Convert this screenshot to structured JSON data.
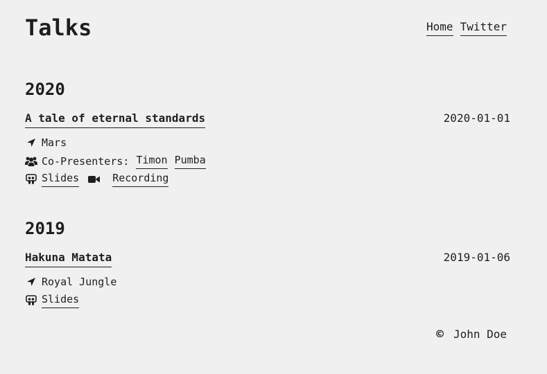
{
  "site": {
    "title": "Talks",
    "nav": [
      {
        "label": "Home"
      },
      {
        "label": "Twitter"
      }
    ]
  },
  "years": [
    {
      "year": "2020",
      "talks": [
        {
          "title": "A tale of eternal standards",
          "date": "2020-01-01",
          "location": "Mars",
          "copresenters_label": "Co-Presenters:",
          "copresenters": [
            "Timon",
            "Pumba"
          ],
          "slides_label": "Slides",
          "recording_label": "Recording"
        }
      ]
    },
    {
      "year": "2019",
      "talks": [
        {
          "title": "Hakuna Matata",
          "date": "2019-01-06",
          "location": "Royal Jungle",
          "slides_label": "Slides"
        }
      ]
    }
  ],
  "footer": {
    "symbol": "©",
    "author": "John Doe"
  },
  "icons": {
    "location": "location-arrow-icon",
    "people": "users-icon",
    "slides": "slideshare-icon",
    "recording": "video-camera-icon"
  }
}
